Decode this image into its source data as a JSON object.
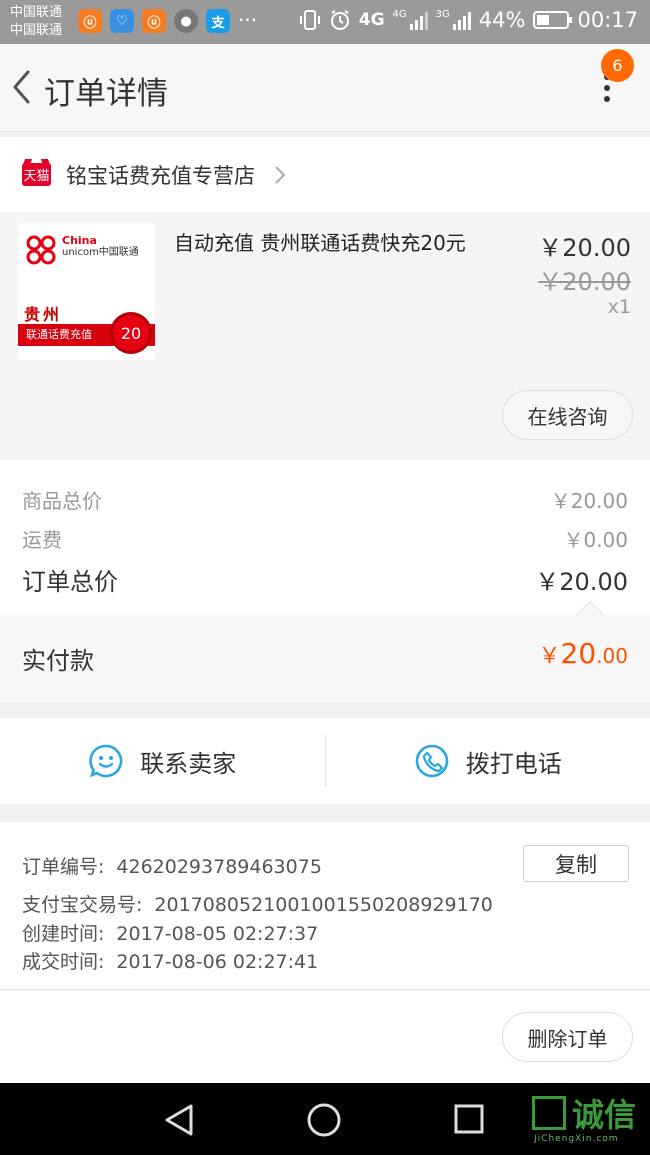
{
  "status_bar": {
    "carriers": [
      "中国联通",
      "中国联通"
    ],
    "app_icons": [
      {
        "name": "uc-browser-icon",
        "glyph": "㉨",
        "color": "#f57c22"
      },
      {
        "name": "health-icon",
        "glyph": "♡",
        "color": "#3b8fe0"
      },
      {
        "name": "uc-browser-icon",
        "glyph": "㉨",
        "color": "#f57c22"
      },
      {
        "name": "avatar-icon",
        "glyph": "●",
        "color": "#777777"
      },
      {
        "name": "alipay-icon",
        "glyph": "支",
        "color": "#1c9ce8"
      }
    ],
    "more_dots": "···",
    "network_1": "4G",
    "network_2": "4G",
    "network_3": "3G",
    "battery_text": "44%",
    "battery_level": 0.44,
    "time": "00:17"
  },
  "header": {
    "title": "订单详情",
    "badge_count": "6"
  },
  "store": {
    "badge": "天猫",
    "name": "铭宝话费充值专营店"
  },
  "product": {
    "thumb": {
      "brand_cn": "China",
      "brand_en": "unicom中国联通",
      "province": "贵州",
      "banner": "联通话费充值",
      "amount": "20"
    },
    "name": "自动充值 贵州联通话费快充20元",
    "price": "￥20.00",
    "original_price": "￥20.00",
    "quantity": "x1",
    "consult_label": "在线咨询"
  },
  "totals": {
    "goods_label": "商品总价",
    "goods_value": "￥20.00",
    "shipping_label": "运费",
    "shipping_value": "￥0.00",
    "order_label": "订单总价",
    "order_value": "￥20.00",
    "paid_label": "实付款",
    "paid_currency": "￥",
    "paid_integer": "20",
    "paid_decimal": ".00"
  },
  "actions": {
    "contact_seller": "联系卖家",
    "call_phone": "拨打电话"
  },
  "order_info": {
    "order_no_label": "订单编号:",
    "order_no": "42620293789463075",
    "copy_label": "复制",
    "alipay_no_label": "支付宝交易号:",
    "alipay_no": "2017080521001001550208929170",
    "created_label": "创建时间:",
    "created": "2017-08-05 02:27:37",
    "completed_label": "成交时间:",
    "completed": "2017-08-06 02:27:41"
  },
  "bottom": {
    "delete_label": "删除订单"
  },
  "watermark": {
    "text": "诚信",
    "sub": "JiChengXin.com"
  },
  "colors": {
    "accent_orange": "#ff5000",
    "tmall_red": "#e4002b",
    "icon_blue": "#2aa5e8"
  }
}
